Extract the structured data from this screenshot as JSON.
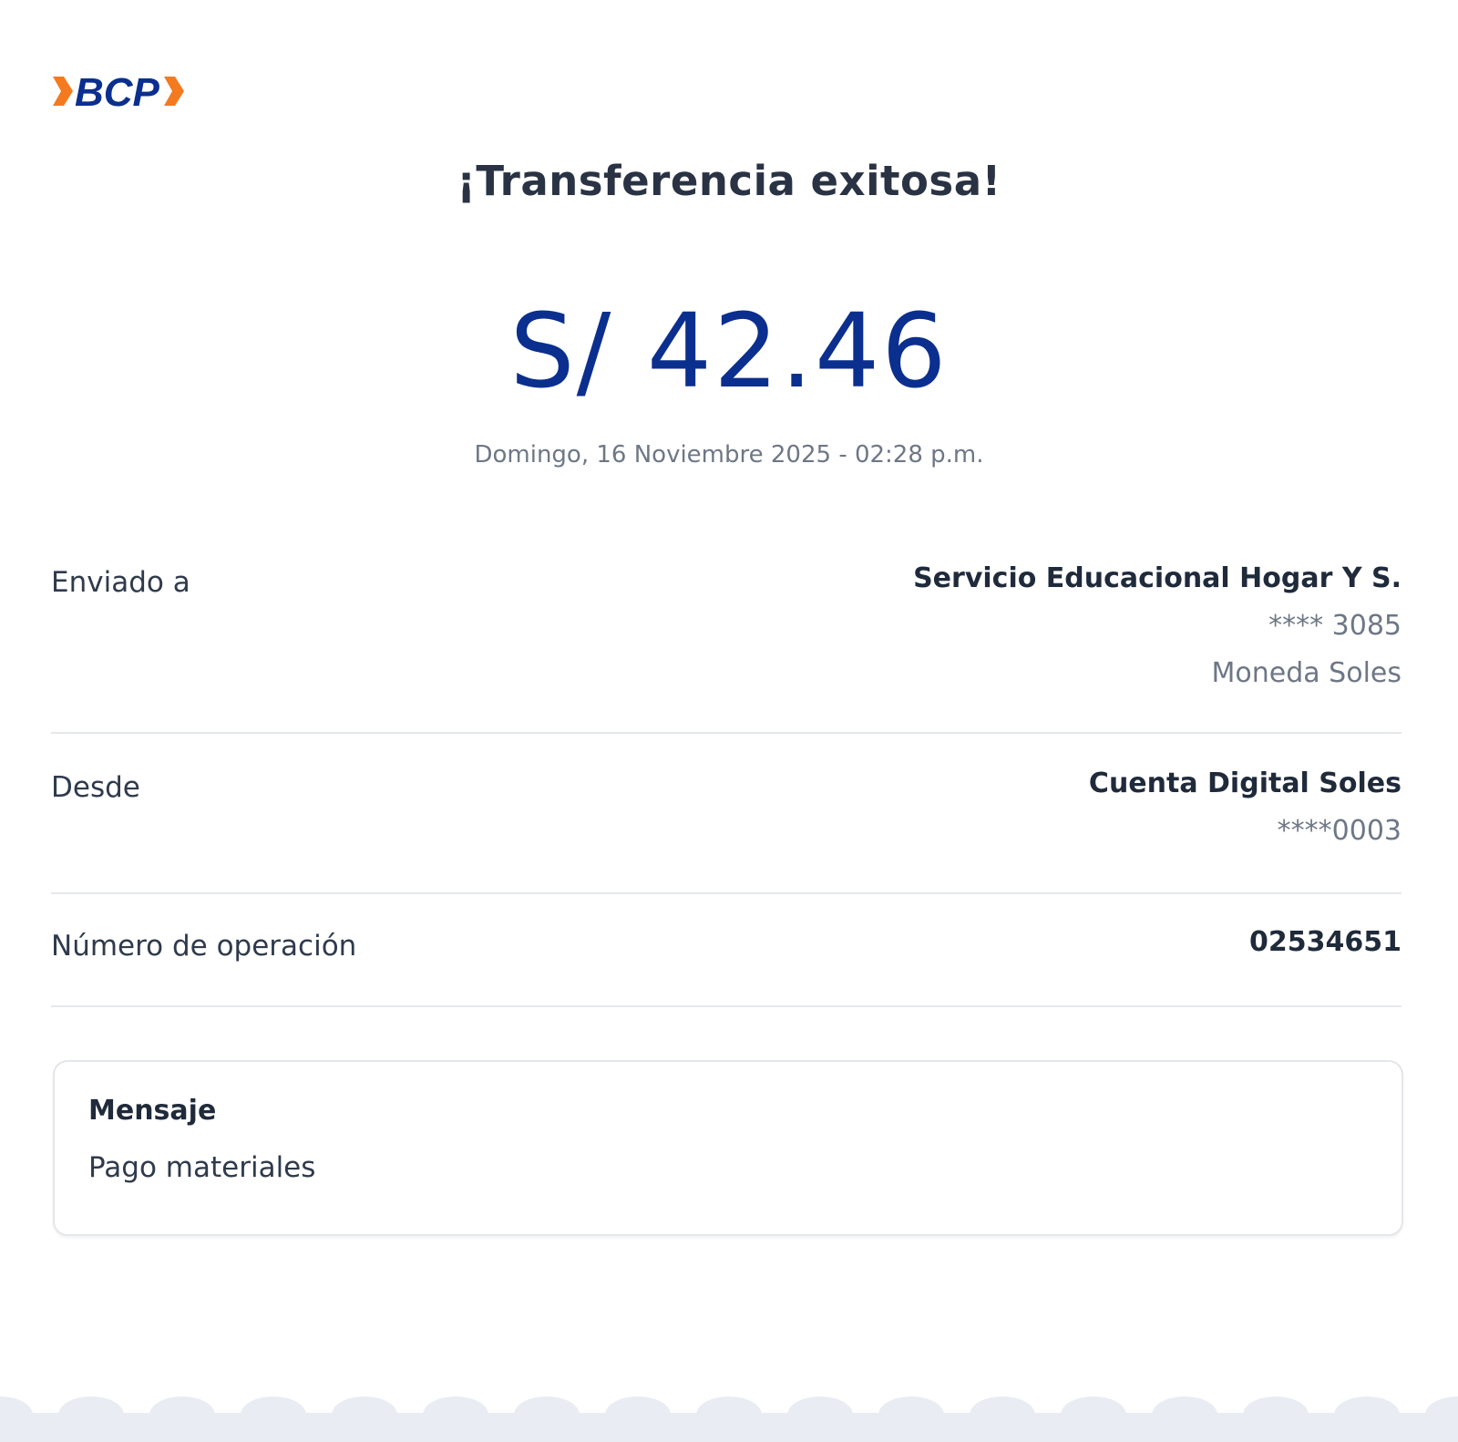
{
  "brand": {
    "logo_text": "BCP",
    "colors": {
      "blue": "#0b2f8e",
      "orange": "#f47a20"
    }
  },
  "receipt": {
    "title": "¡Transferencia exitosa!",
    "amount": "S/ 42.46",
    "datetime": "Domingo, 16 Noviembre 2025 - 02:28 p.m."
  },
  "details": {
    "sent_to": {
      "label": "Enviado a",
      "name": "Servicio Educacional Hogar Y S.",
      "account": "**** 3085",
      "currency": "Moneda Soles"
    },
    "from": {
      "label": "Desde",
      "account_name": "Cuenta Digital Soles",
      "account": "****0003"
    },
    "operation": {
      "label": "Número de operación",
      "value": "02534651"
    }
  },
  "message": {
    "title": "Mensaje",
    "text": "Pago materiales"
  },
  "footer": {
    "scallop_color": "#e9edf3"
  }
}
